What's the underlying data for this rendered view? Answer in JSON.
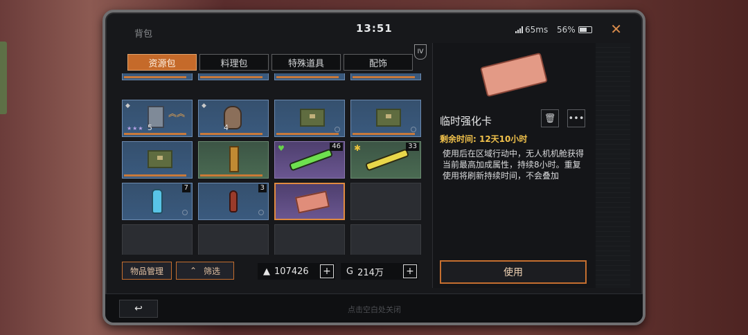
{
  "window": {
    "title": "背包",
    "close_icon": "close-icon"
  },
  "status": {
    "time": "13:51",
    "latency": "65ms",
    "battery": "56%"
  },
  "tabs": [
    {
      "label": "资源包",
      "active": true
    },
    {
      "label": "料理包",
      "active": false
    },
    {
      "label": "特殊道具",
      "active": false
    },
    {
      "label": "配饰",
      "active": false
    }
  ],
  "tier_badge": "IV",
  "grid": {
    "slots": [
      {
        "type": "blue",
        "icon": "mech-icon",
        "gem": "◆",
        "stars": "★★★",
        "level": "5",
        "rank_up": "︽︽"
      },
      {
        "type": "blue",
        "icon": "head-icon",
        "gem": "◆",
        "stars": "",
        "level": "4"
      },
      {
        "type": "blue",
        "icon": "crate-icon"
      },
      {
        "type": "blue",
        "icon": "crate-icon"
      },
      {
        "type": "blue",
        "icon": "crate-icon"
      },
      {
        "type": "green",
        "icon": "pillar-icon"
      },
      {
        "type": "purple",
        "icon": "syringe-green-icon",
        "count": "46",
        "badge": "♥"
      },
      {
        "type": "green",
        "icon": "syringe-yellow-icon",
        "count": "33",
        "badge": "✱"
      },
      {
        "type": "blue",
        "icon": "bottle-blue-icon",
        "count": "7"
      },
      {
        "type": "blue",
        "icon": "bottle-red-icon",
        "count": "3"
      },
      {
        "type": "purple",
        "icon": "card-icon",
        "selected": true
      },
      {
        "type": "empty"
      },
      {
        "type": "empty"
      },
      {
        "type": "empty"
      },
      {
        "type": "empty"
      },
      {
        "type": "empty"
      }
    ]
  },
  "bottom": {
    "manage": "物品管理",
    "filter": "筛选",
    "currency1": {
      "icon": "credits-icon",
      "value": "107426"
    },
    "currency2": {
      "icon": "gold-icon",
      "value": "214万"
    }
  },
  "detail": {
    "name": "临时强化卡",
    "remaining_label": "剩余时间: ",
    "remaining_value": "12天10小时",
    "description": "使用后在区域行动中，无人机机舱获得当前最高加成属性，持续8小时。重复使用将刷新持续时间，不会叠加",
    "use_label": "使用"
  },
  "footer": {
    "hint": "点击空白处关闭"
  }
}
